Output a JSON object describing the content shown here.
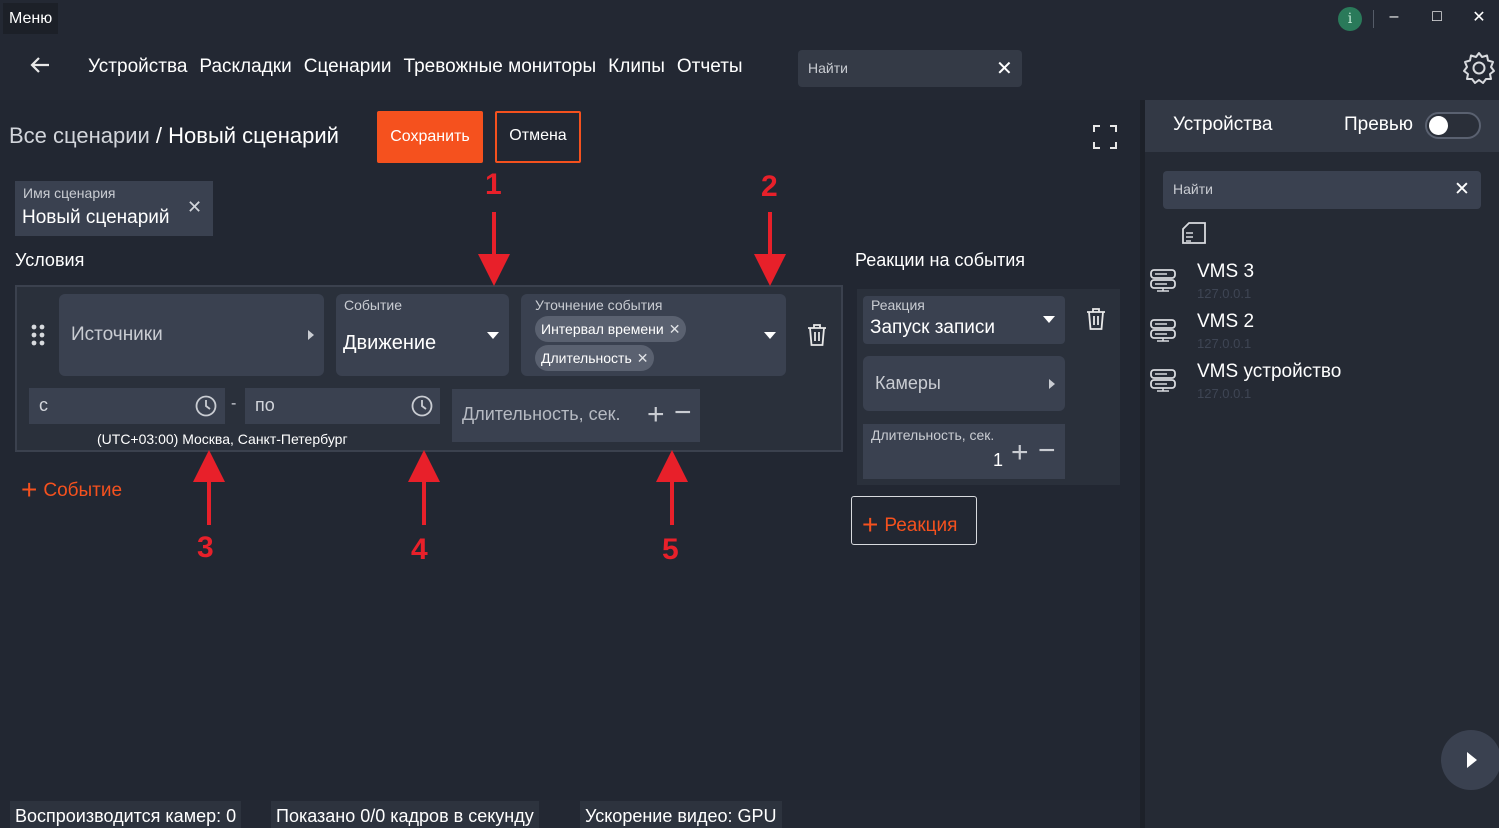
{
  "titlebar": {
    "menu_label": "Меню",
    "info_label": "i",
    "minimize": "–",
    "maximize": "□",
    "close": "✕"
  },
  "nav": {
    "items": [
      "Устройства",
      "Раскладки",
      "Сценарии",
      "Тревожные мониторы",
      "Клипы",
      "Отчеты"
    ],
    "search_placeholder": "Найти"
  },
  "editor": {
    "breadcrumb_parent": "Все сценарии",
    "breadcrumb_sep": " / ",
    "breadcrumb_current": "Новый сценарий",
    "save_label": "Сохранить",
    "cancel_label": "Отмена",
    "name_label": "Имя сценария",
    "name_value": "Новый сценарий"
  },
  "conditions": {
    "title": "Условия",
    "sources_label": "Источники",
    "event_label": "Событие",
    "event_value": "Движение",
    "refine_label": "Уточнение события",
    "refine_chips": [
      "Интервал времени",
      "Длительность"
    ],
    "from_label": "с",
    "to_label": "по",
    "dash": "-",
    "timezone": "(UTC+03:00) Москва, Санкт-Петербург",
    "duration_placeholder": "Длительность, сек.",
    "add_event_label": "Событие"
  },
  "reactions": {
    "title": "Реакции на события",
    "reaction_label": "Реакция",
    "reaction_value": "Запуск записи",
    "cameras_label": "Камеры",
    "duration_label": "Длительность, сек.",
    "duration_value": "1",
    "add_reaction_label": "Реакция"
  },
  "annotations": [
    "1",
    "2",
    "3",
    "4",
    "5"
  ],
  "right_panel": {
    "tab_devices": "Устройства",
    "tab_preview": "Превью",
    "preview_enabled": false,
    "search_placeholder": "Найти",
    "devices": [
      {
        "name": "VMS 3",
        "ip": "127.0.0.1"
      },
      {
        "name": "VMS 2",
        "ip": "127.0.0.1"
      },
      {
        "name": "VMS устройство",
        "ip": "127.0.0.1"
      }
    ]
  },
  "status_bar": {
    "cameras_playing": "Воспроизводится камер: 0",
    "fps": "Показано 0/0 кадров в секунду",
    "acceleration": "Ускорение видео: GPU"
  },
  "colors": {
    "accent": "#f5511e",
    "annotation": "#e8202a",
    "background": "#232833"
  }
}
